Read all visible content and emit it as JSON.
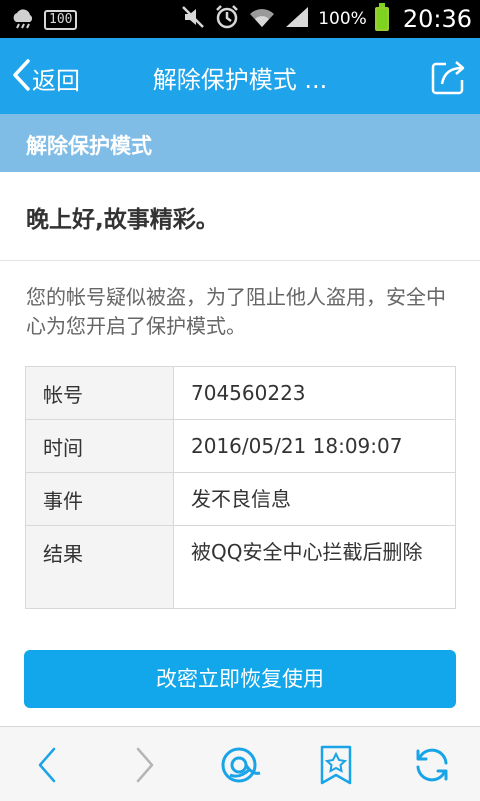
{
  "status_bar": {
    "notification_badge": "100",
    "battery_percent": "100%",
    "clock": "20:36",
    "icons": [
      "cloud-icon",
      "mute-icon",
      "alarm-icon",
      "wifi-icon",
      "signal-icon",
      "battery-icon"
    ]
  },
  "header": {
    "back_label": "返回",
    "title": "解除保护模式 ..."
  },
  "section": {
    "title": "解除保护模式"
  },
  "greeting": "晚上好,故事精彩。",
  "notice": "您的帐号疑似被盗，为了阻止他人盗用，安全中心为您开启了保护模式。",
  "info_table": [
    {
      "key": "帐号",
      "value": "704560223"
    },
    {
      "key": "时间",
      "value": "2016/05/21  18:09:07"
    },
    {
      "key": "事件",
      "value": "发不良信息"
    },
    {
      "key": "结果",
      "value": "被QQ安全中心拦截后删除"
    }
  ],
  "primary_button": "改密立即恢复使用",
  "toolbar": {
    "icons": [
      "back-arrow-icon",
      "forward-arrow-icon",
      "qq-browser-icon",
      "bookmark-icon",
      "refresh-icon"
    ]
  },
  "colors": {
    "title_bar": "#1fa3ea",
    "section_header": "#7fbce6",
    "button": "#12a6ea"
  }
}
